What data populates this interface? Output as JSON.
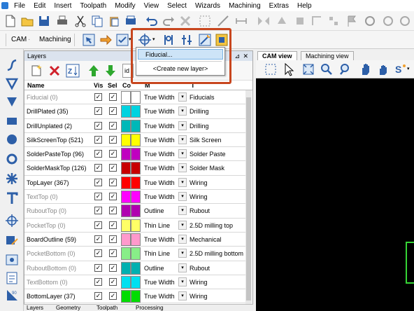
{
  "menubar": {
    "items": [
      "File",
      "Edit",
      "Insert",
      "Toolpath",
      "Modify",
      "View",
      "Select",
      "Wizards",
      "Machining",
      "Extras",
      "Help"
    ]
  },
  "toolbar2": {
    "cam_label": "CAM",
    "machining_label": "Machining"
  },
  "layers_panel": {
    "title": "Layers",
    "search_partial": "id",
    "columns": {
      "name": "Name",
      "vis": "Vis",
      "sel": "Sel",
      "color": "Co",
      "mode": "M",
      "type": "T"
    },
    "rows": [
      {
        "name": "Fiducial (0)",
        "dim": true,
        "vis": true,
        "sel": true,
        "c1": "#ffffff",
        "c2": "#ffffff",
        "mode": "True Width",
        "type": "Fiducials"
      },
      {
        "name": "DrillPlated (35)",
        "dim": false,
        "vis": true,
        "sel": true,
        "c1": "#00d3e0",
        "c2": "#00d3e0",
        "mode": "True Width",
        "type": "Drilling"
      },
      {
        "name": "DrillUnplated (2)",
        "dim": false,
        "vis": true,
        "sel": true,
        "c1": "#00b8b8",
        "c2": "#00b8b8",
        "mode": "True Width",
        "type": "Drilling"
      },
      {
        "name": "SilkScreenTop (521)",
        "dim": false,
        "vis": true,
        "sel": true,
        "c1": "#ffff00",
        "c2": "#ffff00",
        "mode": "True Width",
        "type": "Silk Screen"
      },
      {
        "name": "SolderPasteTop (96)",
        "dim": false,
        "vis": true,
        "sel": true,
        "c1": "#c000c0",
        "c2": "#c000c0",
        "mode": "True Width",
        "type": "Solder Paste"
      },
      {
        "name": "SolderMaskTop (126)",
        "dim": false,
        "vis": true,
        "sel": true,
        "c1": "#c80000",
        "c2": "#c80000",
        "mode": "True Width",
        "type": "Solder Mask"
      },
      {
        "name": "TopLayer (367)",
        "dim": false,
        "vis": true,
        "sel": true,
        "c1": "#ff0000",
        "c2": "#ff0000",
        "mode": "True Width",
        "type": "Wiring"
      },
      {
        "name": "TextTop (0)",
        "dim": true,
        "vis": true,
        "sel": true,
        "c1": "#ff00ff",
        "c2": "#ff00ff",
        "mode": "True Width",
        "type": "Wiring"
      },
      {
        "name": "RuboutTop (0)",
        "dim": true,
        "vis": true,
        "sel": true,
        "c1": "#b000b0",
        "c2": "#b000b0",
        "mode": "Outline",
        "type": "Rubout"
      },
      {
        "name": "PocketTop (0)",
        "dim": true,
        "vis": true,
        "sel": true,
        "c1": "#ffff66",
        "c2": "#ffff66",
        "mode": "Thin Line",
        "type": "2.5D milling top"
      },
      {
        "name": "BoardOutline (59)",
        "dim": false,
        "vis": true,
        "sel": true,
        "c1": "#ff99cc",
        "c2": "#ff99cc",
        "mode": "True Width",
        "type": "Mechanical"
      },
      {
        "name": "PocketBottom (0)",
        "dim": true,
        "vis": true,
        "sel": true,
        "c1": "#88ee88",
        "c2": "#88ee88",
        "mode": "Thin Line",
        "type": "2.5D milling bottom"
      },
      {
        "name": "RuboutBottom (0)",
        "dim": true,
        "vis": true,
        "sel": true,
        "c1": "#00b0b0",
        "c2": "#00b0b0",
        "mode": "Outline",
        "type": "Rubout"
      },
      {
        "name": "TextBottom (0)",
        "dim": true,
        "vis": true,
        "sel": true,
        "c1": "#00e0f0",
        "c2": "#00e0f0",
        "mode": "True Width",
        "type": "Wiring"
      },
      {
        "name": "BottomLayer (37)",
        "dim": false,
        "vis": true,
        "sel": true,
        "c1": "#00dd00",
        "c2": "#00dd00",
        "mode": "True Width",
        "type": "Wiring"
      }
    ]
  },
  "bottom_tabs": [
    "Layers",
    "Geometry",
    "Toolpath",
    "Processing"
  ],
  "view_tabs": {
    "cam_view": "CAM view",
    "machining_view": "Machining view"
  },
  "dropdown": {
    "item_fiducial": "Fiducial...",
    "item_new_layer": "<Create new layer>"
  },
  "colors": {
    "highlight_border": "#c8461e",
    "canvas": "#000000",
    "accent_green": "#35d435"
  }
}
